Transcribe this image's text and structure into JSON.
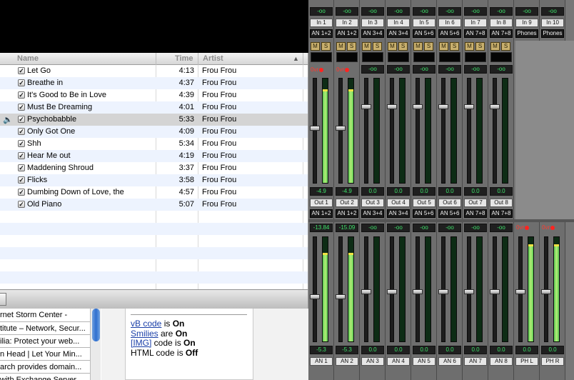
{
  "itunes": {
    "columns": {
      "name": "Name",
      "time": "Time",
      "artist": "Artist",
      "sort_arrow": "▲"
    },
    "tracks": [
      {
        "name": "Let Go",
        "time": "4:13",
        "artist": "Frou Frou",
        "checked": true
      },
      {
        "name": "Breathe in",
        "time": "4:37",
        "artist": "Frou Frou",
        "checked": true
      },
      {
        "name": "It's Good to Be in Love",
        "time": "4:39",
        "artist": "Frou Frou",
        "checked": true
      },
      {
        "name": "Must Be Dreaming",
        "time": "4:01",
        "artist": "Frou Frou",
        "checked": true
      },
      {
        "name": "Psychobabble",
        "time": "5:33",
        "artist": "Frou Frou",
        "checked": true,
        "playing": true
      },
      {
        "name": "Only Got One",
        "time": "4:09",
        "artist": "Frou Frou",
        "checked": true
      },
      {
        "name": "Shh",
        "time": "5:34",
        "artist": "Frou Frou",
        "checked": true
      },
      {
        "name": "Hear Me out",
        "time": "4:19",
        "artist": "Frou Frou",
        "checked": true
      },
      {
        "name": "Maddening Shroud",
        "time": "3:37",
        "artist": "Frou Frou",
        "checked": true
      },
      {
        "name": "Flicks",
        "time": "3:58",
        "artist": "Frou Frou",
        "checked": true
      },
      {
        "name": "Dumbing Down of Love, the",
        "time": "4:57",
        "artist": "Frou Frou",
        "checked": true
      },
      {
        "name": "Old Piano",
        "time": "5:07",
        "artist": "Frou Frou",
        "checked": true
      }
    ],
    "empty_rows": 6,
    "speaker_icon": "speaker-icon",
    "check_mark": "✓"
  },
  "browser": {
    "links": [
      "rnet Storm Center -",
      "titute – Network, Secur...",
      "ilia: Protect your web...",
      "n Head | Let Your Min...",
      "arch provides domain...",
      "with Exchange Server"
    ],
    "settings": [
      {
        "label": "vB code",
        "is_link": true,
        "verb": " is ",
        "state": "On"
      },
      {
        "label": "Smilies",
        "is_link": true,
        "verb": " are ",
        "state": "On"
      },
      {
        "label": "[IMG]",
        "is_link": true,
        "verb": " code is ",
        "state": "On"
      },
      {
        "label": "HTML code",
        "is_link": false,
        "verb": " is ",
        "state": "Off"
      }
    ]
  },
  "mixer": {
    "top_row": {
      "values": [
        "-oo",
        "-oo",
        "-oo",
        "-oo",
        "-oo",
        "-oo",
        "-oo",
        "-oo",
        "-oo",
        "-oo"
      ],
      "inputs": [
        "In 1",
        "In 2",
        "In 3",
        "In 4",
        "In 5",
        "In 6",
        "In 7",
        "In 8",
        "In 9",
        "In 10"
      ],
      "groups": [
        "AN 1+2",
        "AN 1+2",
        "AN 3+4",
        "AN 3+4",
        "AN 5+6",
        "AN 5+6",
        "AN 7+8",
        "AN 7+8",
        "Phones",
        "Phones"
      ],
      "mute_label": "M",
      "solo_label": "S"
    },
    "input_strips": [
      {
        "top": "0vr",
        "overload": true,
        "gain": "-4.9",
        "out": "Out 1",
        "route": "AN 1+2",
        "level": 0.9,
        "fader": 0.55
      },
      {
        "top": "0vr",
        "overload": true,
        "gain": "-4.9",
        "out": "Out 2",
        "route": "AN 1+2",
        "level": 0.9,
        "fader": 0.55
      },
      {
        "top": "-oo",
        "overload": false,
        "gain": "0.0",
        "out": "Out 3",
        "route": "AN 3+4",
        "level": 0.0,
        "fader": 0.75
      },
      {
        "top": "-oo",
        "overload": false,
        "gain": "0.0",
        "out": "Out 4",
        "route": "AN 3+4",
        "level": 0.0,
        "fader": 0.75
      },
      {
        "top": "-oo",
        "overload": false,
        "gain": "0.0",
        "out": "Out 5",
        "route": "AN 5+6",
        "level": 0.0,
        "fader": 0.75
      },
      {
        "top": "-oo",
        "overload": false,
        "gain": "0.0",
        "out": "Out 6",
        "route": "AN 5+6",
        "level": 0.0,
        "fader": 0.75
      },
      {
        "top": "-oo",
        "overload": false,
        "gain": "0.0",
        "out": "Out 7",
        "route": "AN 7+8",
        "level": 0.0,
        "fader": 0.75
      },
      {
        "top": "-oo",
        "overload": false,
        "gain": "0.0",
        "out": "Out 8",
        "route": "AN 7+8",
        "level": 0.0,
        "fader": 0.75
      }
    ],
    "output_strips": [
      {
        "top": "-13.84",
        "overload": false,
        "gain": "-5.3",
        "label": "AN 1",
        "level": 0.85,
        "fader": 0.45
      },
      {
        "top": "-15.09",
        "overload": false,
        "gain": "-5.3",
        "label": "AN 2",
        "level": 0.85,
        "fader": 0.45
      },
      {
        "top": "-oo",
        "overload": false,
        "gain": "0.0",
        "label": "AN 3",
        "level": 0.0,
        "fader": 0.5
      },
      {
        "top": "-oo",
        "overload": false,
        "gain": "0.0",
        "label": "AN 4",
        "level": 0.0,
        "fader": 0.5
      },
      {
        "top": "-oo",
        "overload": false,
        "gain": "0.0",
        "label": "AN 5",
        "level": 0.0,
        "fader": 0.5
      },
      {
        "top": "-oo",
        "overload": false,
        "gain": "0.0",
        "label": "AN 6",
        "level": 0.0,
        "fader": 0.5
      },
      {
        "top": "-oo",
        "overload": false,
        "gain": "0.0",
        "label": "AN 7",
        "level": 0.0,
        "fader": 0.5
      },
      {
        "top": "-oo",
        "overload": false,
        "gain": "0.0",
        "label": "AN 8",
        "level": 0.0,
        "fader": 0.5
      },
      {
        "top": "0vr",
        "overload": true,
        "gain": "0.0",
        "label": "PH L",
        "level": 0.93,
        "fader": 0.5
      },
      {
        "top": "0vr",
        "overload": true,
        "gain": "0.0",
        "label": "PH R",
        "level": 0.93,
        "fader": 0.5
      }
    ]
  },
  "colors": {
    "meter_green": "#58c953",
    "overload_red": "#ff2420",
    "value_green": "#3ee36b",
    "playing_row": "#d4d4d4"
  }
}
